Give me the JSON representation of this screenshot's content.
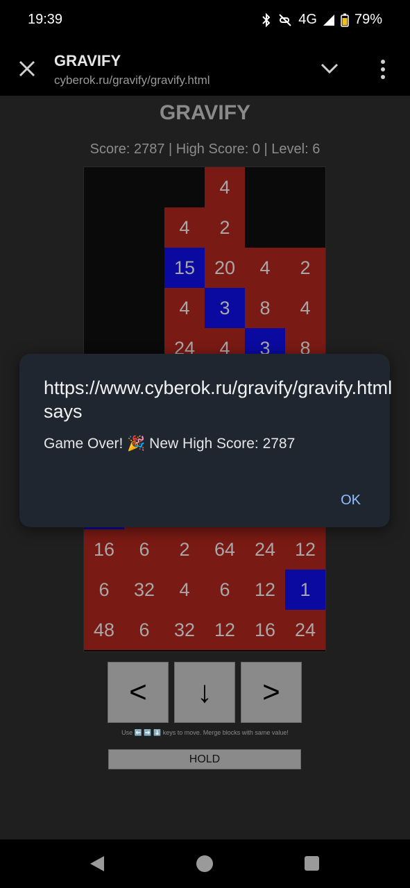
{
  "status_bar": {
    "time": "19:39",
    "network": "4G",
    "battery": "79%",
    "icons": [
      "bluetooth-icon",
      "mute-icon",
      "signal-icon",
      "battery-icon"
    ]
  },
  "browser": {
    "title": "GRAVIFY",
    "url": "cyberok.ru/gravify/gravify.html"
  },
  "game": {
    "title": "GRAVIFY",
    "score_line": "Score: 2787 | High Score: 0 | Level: 6",
    "board": {
      "columns": 6,
      "cells": [
        {
          "row": 0,
          "col": 3,
          "value": "4",
          "color": "red"
        },
        {
          "row": 1,
          "col": 2,
          "value": "4",
          "color": "red"
        },
        {
          "row": 1,
          "col": 3,
          "value": "2",
          "color": "red"
        },
        {
          "row": 2,
          "col": 2,
          "value": "15",
          "color": "blue"
        },
        {
          "row": 2,
          "col": 3,
          "value": "20",
          "color": "red"
        },
        {
          "row": 2,
          "col": 4,
          "value": "4",
          "color": "red"
        },
        {
          "row": 2,
          "col": 5,
          "value": "2",
          "color": "red"
        },
        {
          "row": 3,
          "col": 2,
          "value": "4",
          "color": "red"
        },
        {
          "row": 3,
          "col": 3,
          "value": "3",
          "color": "blue"
        },
        {
          "row": 3,
          "col": 4,
          "value": "8",
          "color": "red"
        },
        {
          "row": 3,
          "col": 5,
          "value": "4",
          "color": "red"
        },
        {
          "row": 4,
          "col": 2,
          "value": "24",
          "color": "red"
        },
        {
          "row": 4,
          "col": 3,
          "value": "4",
          "color": "red"
        },
        {
          "row": 4,
          "col": 4,
          "value": "3",
          "color": "blue"
        },
        {
          "row": 4,
          "col": 5,
          "value": "8",
          "color": "red"
        },
        {
          "row": 5,
          "col": 0,
          "value": "",
          "color": "red"
        },
        {
          "row": 5,
          "col": 1,
          "value": "",
          "color": "red"
        },
        {
          "row": 5,
          "col": 2,
          "value": "",
          "color": "red"
        },
        {
          "row": 5,
          "col": 3,
          "value": "",
          "color": "red"
        },
        {
          "row": 5,
          "col": 4,
          "value": "",
          "color": "red"
        },
        {
          "row": 5,
          "col": 5,
          "value": "",
          "color": "red"
        },
        {
          "row": 6,
          "col": 0,
          "value": "",
          "color": "red"
        },
        {
          "row": 6,
          "col": 1,
          "value": "",
          "color": "red"
        },
        {
          "row": 6,
          "col": 2,
          "value": "",
          "color": "red"
        },
        {
          "row": 6,
          "col": 3,
          "value": "",
          "color": "red"
        },
        {
          "row": 6,
          "col": 4,
          "value": "",
          "color": "red"
        },
        {
          "row": 6,
          "col": 5,
          "value": "",
          "color": "red"
        },
        {
          "row": 7,
          "col": 0,
          "value": "",
          "color": "red"
        },
        {
          "row": 7,
          "col": 1,
          "value": "",
          "color": "red"
        },
        {
          "row": 7,
          "col": 2,
          "value": "",
          "color": "red"
        },
        {
          "row": 7,
          "col": 3,
          "value": "",
          "color": "red"
        },
        {
          "row": 7,
          "col": 4,
          "value": "",
          "color": "red"
        },
        {
          "row": 7,
          "col": 5,
          "value": "",
          "color": "red"
        },
        {
          "row": 8,
          "col": 0,
          "value": "",
          "color": "blue"
        },
        {
          "row": 8,
          "col": 1,
          "value": "",
          "color": "red"
        },
        {
          "row": 8,
          "col": 2,
          "value": "",
          "color": "red"
        },
        {
          "row": 8,
          "col": 3,
          "value": "",
          "color": "red"
        },
        {
          "row": 8,
          "col": 4,
          "value": "",
          "color": "red"
        },
        {
          "row": 8,
          "col": 5,
          "value": "",
          "color": "red"
        },
        {
          "row": 9,
          "col": 0,
          "value": "16",
          "color": "red"
        },
        {
          "row": 9,
          "col": 1,
          "value": "6",
          "color": "red"
        },
        {
          "row": 9,
          "col": 2,
          "value": "2",
          "color": "red"
        },
        {
          "row": 9,
          "col": 3,
          "value": "64",
          "color": "red"
        },
        {
          "row": 9,
          "col": 4,
          "value": "24",
          "color": "red"
        },
        {
          "row": 9,
          "col": 5,
          "value": "12",
          "color": "red"
        },
        {
          "row": 10,
          "col": 0,
          "value": "6",
          "color": "red"
        },
        {
          "row": 10,
          "col": 1,
          "value": "32",
          "color": "red"
        },
        {
          "row": 10,
          "col": 2,
          "value": "4",
          "color": "red"
        },
        {
          "row": 10,
          "col": 3,
          "value": "6",
          "color": "red"
        },
        {
          "row": 10,
          "col": 4,
          "value": "12",
          "color": "red"
        },
        {
          "row": 10,
          "col": 5,
          "value": "1",
          "color": "blue"
        },
        {
          "row": 11,
          "col": 0,
          "value": "48",
          "color": "red"
        },
        {
          "row": 11,
          "col": 1,
          "value": "6",
          "color": "red"
        },
        {
          "row": 11,
          "col": 2,
          "value": "32",
          "color": "red"
        },
        {
          "row": 11,
          "col": 3,
          "value": "12",
          "color": "red"
        },
        {
          "row": 11,
          "col": 4,
          "value": "16",
          "color": "red"
        },
        {
          "row": 11,
          "col": 5,
          "value": "24",
          "color": "red"
        }
      ]
    },
    "controls": {
      "left_label": "<",
      "down_label": "↓",
      "right_label": ">"
    },
    "help_text": "Use ⬅️ ➡️ ⬇️ keys to move. Merge blocks with same value!",
    "hold_label": "HOLD"
  },
  "dialog": {
    "title": "https://www.cyberok.ru/gravify/gravify.html says",
    "message": "Game Over! 🎉 New High Score: 2787",
    "ok_label": "OK"
  },
  "colors": {
    "block_red": "#7a1a14",
    "block_blue": "#0a0aa0",
    "dialog_bg": "#1f2630",
    "ok_accent": "#8fc0ff"
  }
}
